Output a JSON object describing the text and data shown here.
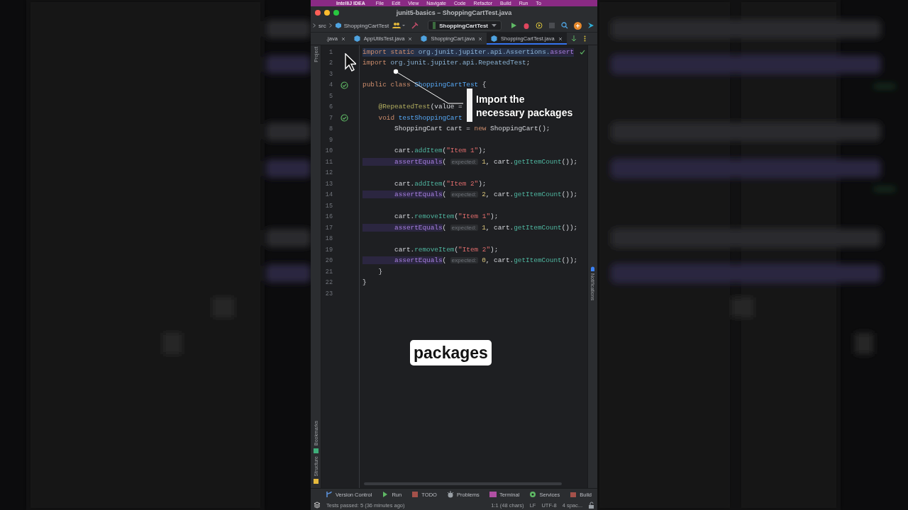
{
  "menu_bar": {
    "items": [
      "IntelliJ IDEA",
      "File",
      "Edit",
      "View",
      "Navigate",
      "Code",
      "Refactor",
      "Build",
      "Run",
      "To"
    ]
  },
  "window": {
    "title": "junit5-basics – ShoppingCartTest.java"
  },
  "nav_bar": {
    "breadcrumb": [
      "src",
      "ShoppingCartTest"
    ],
    "run_config": "ShoppingCartTest"
  },
  "tabs": [
    {
      "label": ".java",
      "selected": false
    },
    {
      "label": "AppUtilsTest.java",
      "selected": false
    },
    {
      "label": "ShoppingCart.java",
      "selected": false
    },
    {
      "label": "ShoppingCartTest.java",
      "selected": true
    }
  ],
  "left_strip": {
    "top": [
      "Project"
    ],
    "bottom": [
      "Bookmarks",
      "Structure"
    ]
  },
  "right_strip": [
    "Notifications"
  ],
  "editor": {
    "lines": [
      {
        "num": "1",
        "highlighted": true,
        "test_passed": false,
        "tokens": [
          {
            "text": "import static ",
            "kind": "kw"
          },
          {
            "text": "org.junit.jupiter.api.Assertions.",
            "kind": "pkg"
          },
          {
            "text": "assert",
            "kind": "call"
          }
        ]
      },
      {
        "num": "2",
        "highlighted": false,
        "test_passed": false,
        "tokens": [
          {
            "text": "import ",
            "kind": "kw"
          },
          {
            "text": "org.junit.jupiter.api.RepeatedTest",
            "kind": "pkg"
          },
          {
            "text": ";",
            "kind": "plain"
          }
        ]
      },
      {
        "num": "3",
        "highlighted": false,
        "test_passed": false
      },
      {
        "num": "4",
        "highlighted": false,
        "test_passed": true,
        "tokens": [
          {
            "text": "public class ",
            "kind": "kw"
          },
          {
            "text": "ShoppingCartTest",
            "kind": "decl"
          },
          {
            "text": " {",
            "kind": "plain"
          }
        ]
      },
      {
        "num": "5",
        "highlighted": false,
        "test_passed": false
      },
      {
        "num": "6",
        "highlighted": false,
        "test_passed": false,
        "tokens": [
          {
            "text": "    @RepeatedTest",
            "kind": "ann"
          },
          {
            "text": "(value = ",
            "kind": "plain"
          }
        ]
      },
      {
        "num": "7",
        "highlighted": false,
        "test_passed": true,
        "tokens": [
          {
            "text": "    void ",
            "kind": "kw"
          },
          {
            "text": "testShoppingCart",
            "kind": "decl"
          }
        ]
      },
      {
        "num": "8",
        "highlighted": false,
        "test_passed": false,
        "tokens": [
          {
            "text": "        ShoppingCart",
            "kind": "plain"
          },
          {
            "text": " cart = ",
            "kind": "plain"
          },
          {
            "text": "new ",
            "kind": "kw"
          },
          {
            "text": "ShoppingCart",
            "kind": "plain"
          },
          {
            "text": "();",
            "kind": "plain"
          }
        ]
      },
      {
        "num": "9",
        "highlighted": false,
        "test_passed": false
      },
      {
        "num": "10",
        "highlighted": false,
        "test_passed": false,
        "tokens": [
          {
            "text": "        cart.",
            "kind": "plain"
          },
          {
            "text": "addItem",
            "kind": "fn"
          },
          {
            "text": "(",
            "kind": "plain"
          },
          {
            "text": "\"Item 1\"",
            "kind": "str"
          },
          {
            "text": ");",
            "kind": "plain"
          }
        ]
      },
      {
        "num": "11",
        "highlighted": false,
        "test_passed": false,
        "tokens": [
          {
            "text": "        assertEquals",
            "kind": "call"
          },
          {
            "text": "( ",
            "kind": "plain"
          },
          {
            "text": "expected:",
            "kind": "hint"
          },
          {
            "text": " 1",
            "kind": "num"
          },
          {
            "text": ", cart.",
            "kind": "plain"
          },
          {
            "text": "getItemCount",
            "kind": "fn"
          },
          {
            "text": "());",
            "kind": "plain"
          }
        ]
      },
      {
        "num": "12",
        "highlighted": false,
        "test_passed": false
      },
      {
        "num": "13",
        "highlighted": false,
        "test_passed": false,
        "tokens": [
          {
            "text": "        cart.",
            "kind": "plain"
          },
          {
            "text": "addItem",
            "kind": "fn"
          },
          {
            "text": "(",
            "kind": "plain"
          },
          {
            "text": "\"Item 2\"",
            "kind": "str"
          },
          {
            "text": ");",
            "kind": "plain"
          }
        ]
      },
      {
        "num": "14",
        "highlighted": false,
        "test_passed": false,
        "tokens": [
          {
            "text": "        assertEquals",
            "kind": "call"
          },
          {
            "text": "( ",
            "kind": "plain"
          },
          {
            "text": "expected:",
            "kind": "hint"
          },
          {
            "text": " 2",
            "kind": "num"
          },
          {
            "text": ", cart.",
            "kind": "plain"
          },
          {
            "text": "getItemCount",
            "kind": "fn"
          },
          {
            "text": "());",
            "kind": "plain"
          }
        ]
      },
      {
        "num": "15",
        "highlighted": false,
        "test_passed": false
      },
      {
        "num": "16",
        "highlighted": false,
        "test_passed": false,
        "tokens": [
          {
            "text": "        cart.",
            "kind": "plain"
          },
          {
            "text": "removeItem",
            "kind": "fn"
          },
          {
            "text": "(",
            "kind": "plain"
          },
          {
            "text": "\"Item 1\"",
            "kind": "str"
          },
          {
            "text": ");",
            "kind": "plain"
          }
        ]
      },
      {
        "num": "17",
        "highlighted": false,
        "test_passed": false,
        "tokens": [
          {
            "text": "        assertEquals",
            "kind": "call"
          },
          {
            "text": "( ",
            "kind": "plain"
          },
          {
            "text": "expected:",
            "kind": "hint"
          },
          {
            "text": " 1",
            "kind": "num"
          },
          {
            "text": ", cart.",
            "kind": "plain"
          },
          {
            "text": "getItemCount",
            "kind": "fn"
          },
          {
            "text": "());",
            "kind": "plain"
          }
        ]
      },
      {
        "num": "18",
        "highlighted": false,
        "test_passed": false
      },
      {
        "num": "19",
        "highlighted": false,
        "test_passed": false,
        "tokens": [
          {
            "text": "        cart.",
            "kind": "plain"
          },
          {
            "text": "removeItem",
            "kind": "fn"
          },
          {
            "text": "(",
            "kind": "plain"
          },
          {
            "text": "\"Item 2\"",
            "kind": "str"
          },
          {
            "text": ");",
            "kind": "plain"
          }
        ]
      },
      {
        "num": "20",
        "highlighted": false,
        "test_passed": false,
        "tokens": [
          {
            "text": "        assertEquals",
            "kind": "call"
          },
          {
            "text": "( ",
            "kind": "plain"
          },
          {
            "text": "expected:",
            "kind": "hint"
          },
          {
            "text": " 0",
            "kind": "num"
          },
          {
            "text": ", cart.",
            "kind": "plain"
          },
          {
            "text": "getItemCount",
            "kind": "fn"
          },
          {
            "text": "());",
            "kind": "plain"
          }
        ]
      },
      {
        "num": "21",
        "highlighted": false,
        "test_passed": false,
        "tokens": [
          {
            "text": "    }",
            "kind": "plain"
          }
        ]
      },
      {
        "num": "22",
        "highlighted": false,
        "test_passed": false,
        "tokens": [
          {
            "text": "}",
            "kind": "plain"
          }
        ]
      },
      {
        "num": "23",
        "highlighted": false,
        "test_passed": false
      }
    ]
  },
  "annotation": {
    "text": "Import the\nnecessary packages"
  },
  "caption": {
    "text": "packages"
  },
  "tool_windows": [
    {
      "label": "Version Control",
      "kind": "vcs"
    },
    {
      "label": "Run",
      "kind": "run"
    },
    {
      "label": "TODO",
      "kind": "todo"
    },
    {
      "label": "Problems",
      "kind": "problems"
    },
    {
      "label": "Terminal",
      "kind": "terminal"
    },
    {
      "label": "Services",
      "kind": "services"
    },
    {
      "label": "Build",
      "kind": "build"
    }
  ],
  "status_bar": {
    "message": "Tests passed: 5 (36 minutes ago)",
    "items": [
      "1:1 (48 chars)",
      "LF",
      "UTF-8",
      "4 spac..."
    ]
  }
}
